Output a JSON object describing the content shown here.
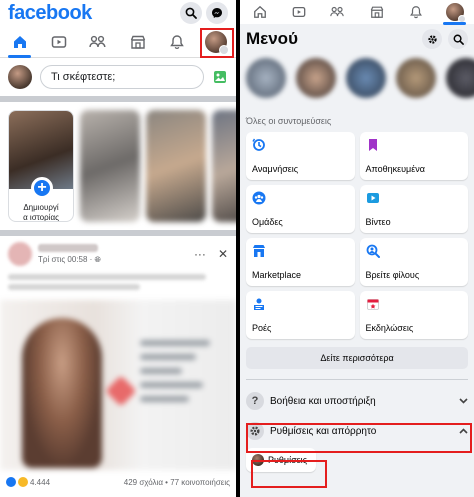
{
  "left": {
    "logo": "facebook",
    "compose_placeholder": "Τι σκέφτεστε;",
    "story": {
      "label_line1": "Δημιουργί",
      "label_line2": "α ιστορίας",
      "plus": "+"
    },
    "post": {
      "time": "Τρί στις 00:58 · ",
      "more": "···",
      "close": "✕",
      "reactions_count": "4.444",
      "stats": "429 σχόλια • 77 κοινοποιήσεις"
    }
  },
  "right": {
    "title": "Μενού",
    "shortcuts_label": "Όλες οι συντομεύσεις",
    "tiles": [
      {
        "label": "Αναμνήσεις",
        "icon": "memories-icon",
        "color": "#1877f2"
      },
      {
        "label": "Αποθηκευμένα",
        "icon": "saved-icon",
        "color": "#a033c8"
      },
      {
        "label": "Ομάδες",
        "icon": "groups-icon",
        "color": "#1877f2"
      },
      {
        "label": "Βίντεο",
        "icon": "video-icon",
        "color": "#1b9be0"
      },
      {
        "label": "Marketplace",
        "icon": "marketplace-icon",
        "color": "#1877f2"
      },
      {
        "label": "Βρείτε φίλους",
        "icon": "find-friends-icon",
        "color": "#1877f2"
      },
      {
        "label": "Ροές",
        "icon": "feeds-icon",
        "color": "#1877f2"
      },
      {
        "label": "Εκδηλώσεις",
        "icon": "events-icon",
        "color": "#e41e3f"
      }
    ],
    "see_more": "Δείτε περισσότερα",
    "help": {
      "label": "Βοήθεια και υποστήριξη",
      "icon_text": "?"
    },
    "settings": {
      "label": "Ρυθμίσεις και απόρρητο"
    },
    "settings_sub": {
      "label": "Ρυθμίσεις"
    }
  },
  "colors": {
    "brand": "#1877f2",
    "highlight": "#e41e1e"
  }
}
